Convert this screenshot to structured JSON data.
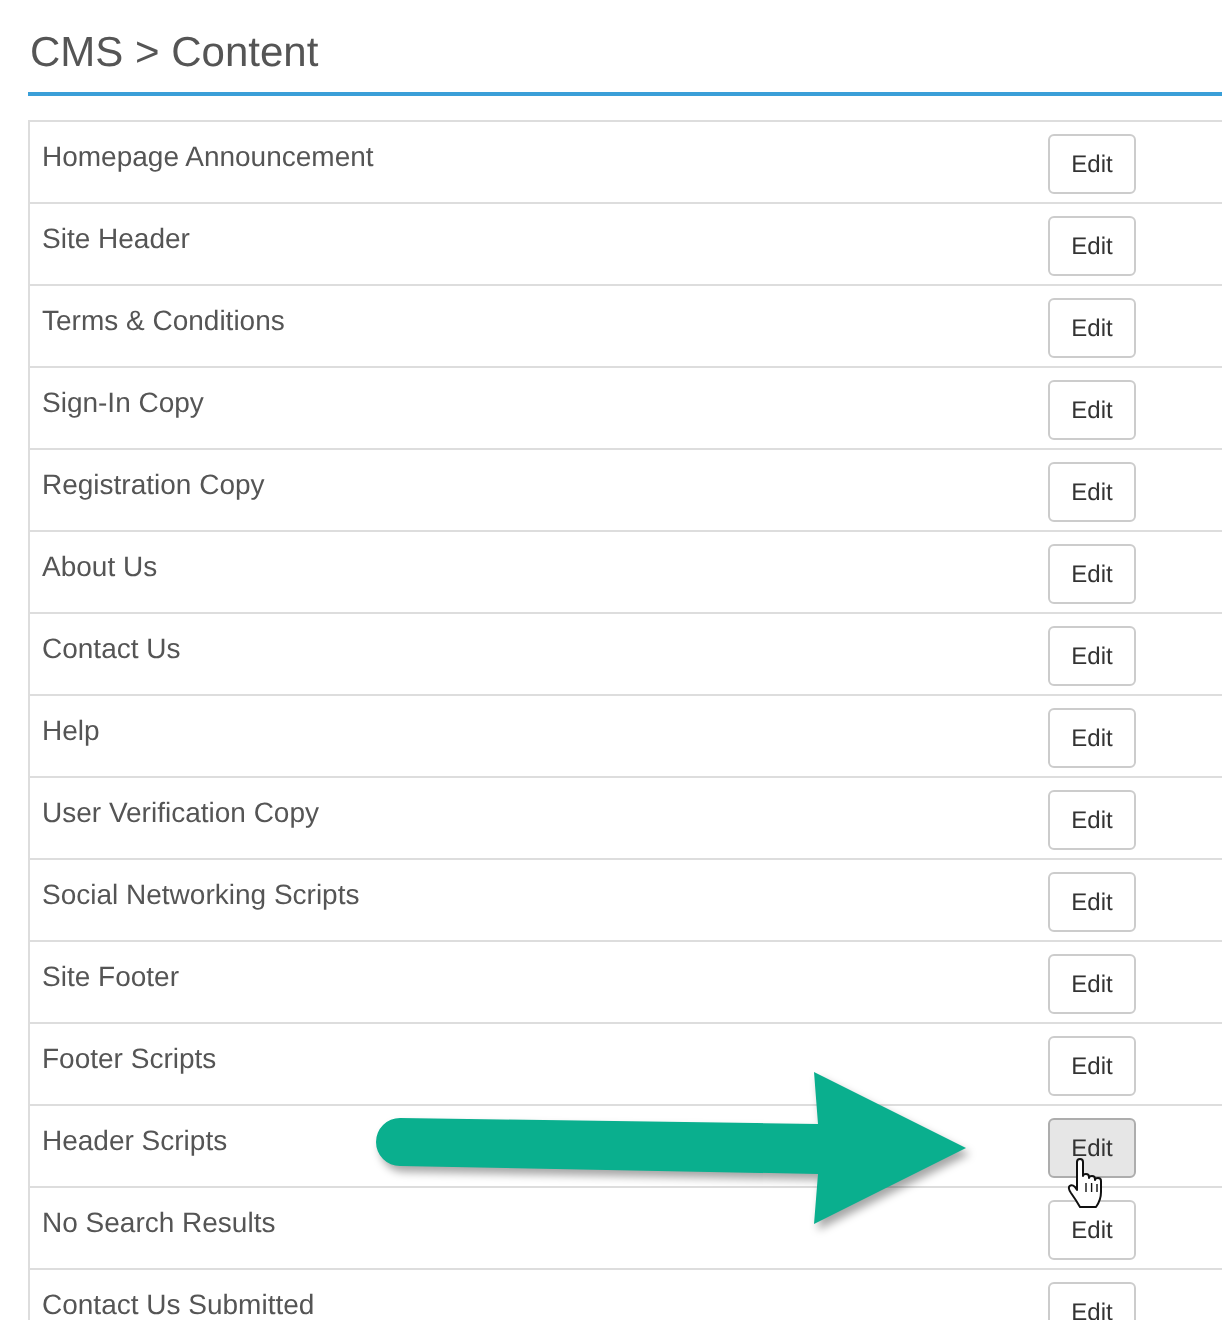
{
  "page": {
    "title": "CMS > Content"
  },
  "items": [
    {
      "label": "Homepage Announcement",
      "action": "Edit",
      "hovered": false
    },
    {
      "label": "Site Header",
      "action": "Edit",
      "hovered": false
    },
    {
      "label": "Terms & Conditions",
      "action": "Edit",
      "hovered": false
    },
    {
      "label": "Sign-In Copy",
      "action": "Edit",
      "hovered": false
    },
    {
      "label": "Registration Copy",
      "action": "Edit",
      "hovered": false
    },
    {
      "label": "About Us",
      "action": "Edit",
      "hovered": false
    },
    {
      "label": "Contact Us",
      "action": "Edit",
      "hovered": false
    },
    {
      "label": "Help",
      "action": "Edit",
      "hovered": false
    },
    {
      "label": "User Verification Copy",
      "action": "Edit",
      "hovered": false
    },
    {
      "label": "Social Networking Scripts",
      "action": "Edit",
      "hovered": false
    },
    {
      "label": "Site Footer",
      "action": "Edit",
      "hovered": false
    },
    {
      "label": "Footer Scripts",
      "action": "Edit",
      "hovered": false
    },
    {
      "label": "Header Scripts",
      "action": "Edit",
      "hovered": true
    },
    {
      "label": "No Search Results",
      "action": "Edit",
      "hovered": false
    },
    {
      "label": "Contact Us Submitted",
      "action": "Edit",
      "hovered": false
    }
  ]
}
